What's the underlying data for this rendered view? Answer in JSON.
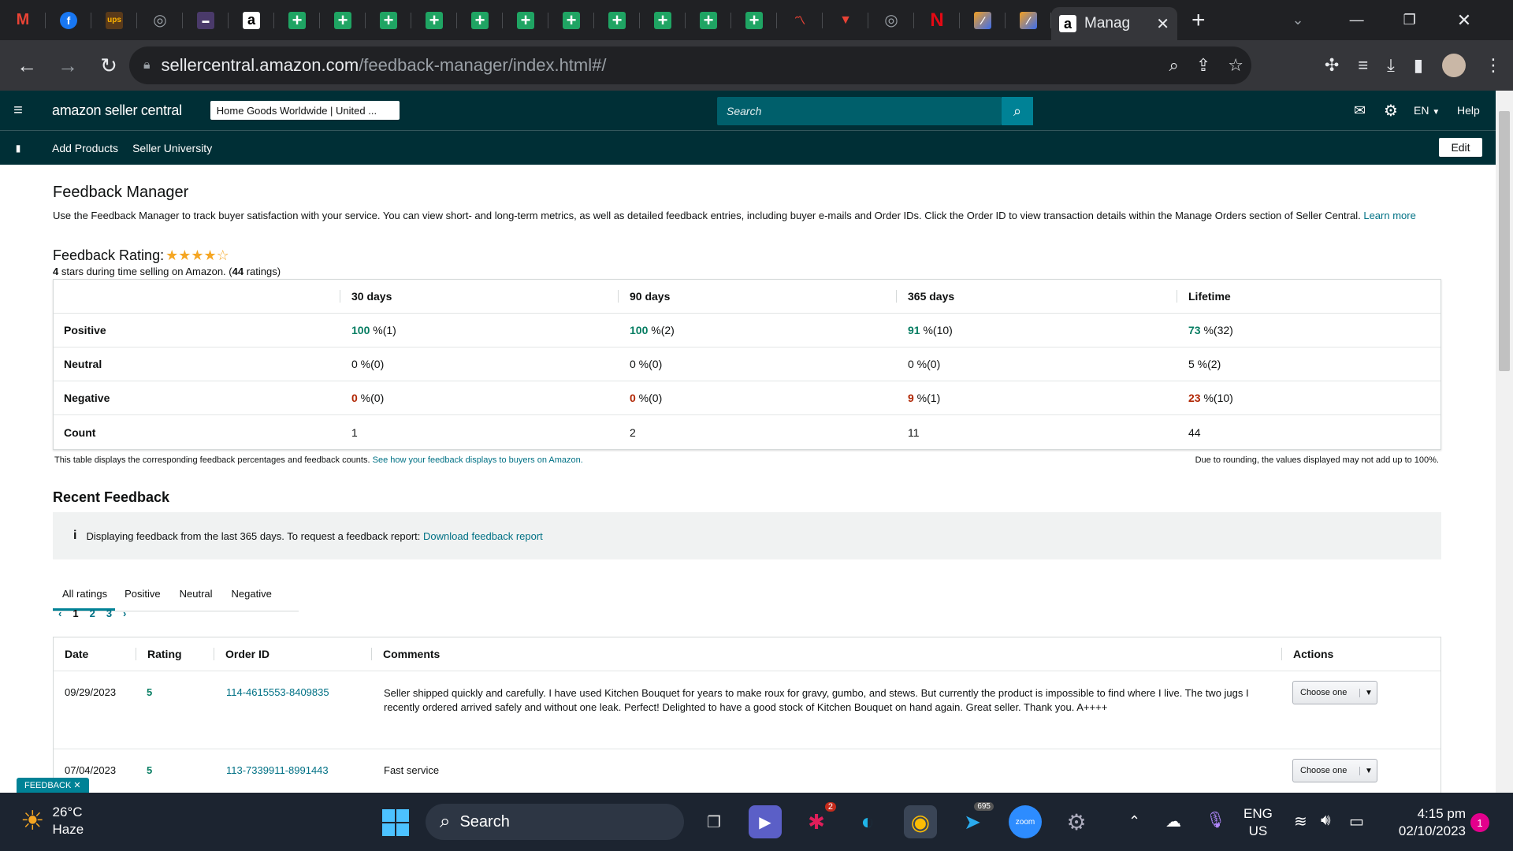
{
  "browser": {
    "active_tab_title": "Manag",
    "url_domain": "sellercentral.amazon.com",
    "url_path": "/feedback-manager/index.html#/"
  },
  "header": {
    "logo": "amazon seller central",
    "store_selector": "Home Goods Worldwide | United ...",
    "search_placeholder": "Search",
    "language": "EN",
    "help": "Help"
  },
  "subnav": {
    "items": [
      "Add Products",
      "Seller University"
    ],
    "edit": "Edit"
  },
  "page": {
    "title": "Feedback Manager",
    "description": "Use the Feedback Manager to track buyer satisfaction with your service. You can view short- and long-term metrics, as well as detailed feedback entries, including buyer e-mails and Order IDs. Click the Order ID to view transaction details within the Manage Orders section of Seller Central.",
    "learn_more": "Learn more",
    "rating_label": "Feedback Rating:",
    "rating_stars": 4,
    "rating_stars_prefix": "4",
    "rating_summary_middle": " stars during time selling on Amazon. (",
    "rating_count": "44",
    "rating_summary_end": " ratings)"
  },
  "metrics": {
    "columns": [
      "30 days",
      "90 days",
      "365 days",
      "Lifetime"
    ],
    "rows": [
      {
        "label": "Positive",
        "cells": [
          {
            "v": "100",
            "r": " %(1)",
            "c": "green"
          },
          {
            "v": "100",
            "r": " %(2)",
            "c": "green"
          },
          {
            "v": "91",
            "r": " %(10)",
            "c": "green"
          },
          {
            "v": "73",
            "r": " %(32)",
            "c": "green"
          }
        ]
      },
      {
        "label": "Neutral",
        "cells": [
          {
            "v": "0",
            "r": " %(0)",
            "c": ""
          },
          {
            "v": "0",
            "r": " %(0)",
            "c": ""
          },
          {
            "v": "0",
            "r": " %(0)",
            "c": ""
          },
          {
            "v": "5",
            "r": " %(2)",
            "c": ""
          }
        ]
      },
      {
        "label": "Negative",
        "cells": [
          {
            "v": "0",
            "r": " %(0)",
            "c": "red"
          },
          {
            "v": "0",
            "r": " %(0)",
            "c": "red"
          },
          {
            "v": "9",
            "r": " %(1)",
            "c": "red"
          },
          {
            "v": "23",
            "r": " %(10)",
            "c": "red"
          }
        ]
      },
      {
        "label": "Count",
        "cells": [
          {
            "v": "1",
            "r": "",
            "c": ""
          },
          {
            "v": "2",
            "r": "",
            "c": ""
          },
          {
            "v": "11",
            "r": "",
            "c": ""
          },
          {
            "v": "44",
            "r": "",
            "c": ""
          }
        ]
      }
    ],
    "footnote": "This table displays the corresponding feedback percentages and feedback counts.",
    "footnote_link": "See how your feedback displays to buyers on Amazon.",
    "rounding_note": "Due to rounding, the values displayed may not add up to 100%."
  },
  "recent": {
    "title": "Recent Feedback",
    "info_text": "Displaying feedback from the last 365 days. To request a feedback report:",
    "info_link": "Download feedback report",
    "tabs": [
      "All ratings",
      "Positive",
      "Neutral",
      "Negative"
    ],
    "pages": [
      "1",
      "2",
      "3"
    ],
    "columns": [
      "Date",
      "Rating",
      "Order ID",
      "Comments",
      "Actions"
    ],
    "rows": [
      {
        "date": "09/29/2023",
        "rating": "5",
        "order_id": "114-4615553-8409835",
        "comment": "Seller shipped quickly and carefully. I have used Kitchen Bouquet for years to make roux for gravy, gumbo, and stews. But currently the product is impossible to find where I live. The two jugs I recently ordered arrived safely and without one leak. Perfect! Delighted to have a good stock of Kitchen Bouquet on hand again. Great seller. Thank you. A++++",
        "action": "Choose one"
      },
      {
        "date": "07/04/2023",
        "rating": "5",
        "order_id": "113-7339911-8991443",
        "comment": "Fast service",
        "action": "Choose one"
      }
    ]
  },
  "feedback_badge": "FEEDBACK",
  "taskbar": {
    "temperature": "26°C",
    "weather": "Haze",
    "search": "Search",
    "lang_line1": "ENG",
    "lang_line2": "US",
    "time": "4:15 pm",
    "date": "02/10/2023",
    "notification_count": "1",
    "slack_badge": "2",
    "telegram_badge": "695"
  }
}
